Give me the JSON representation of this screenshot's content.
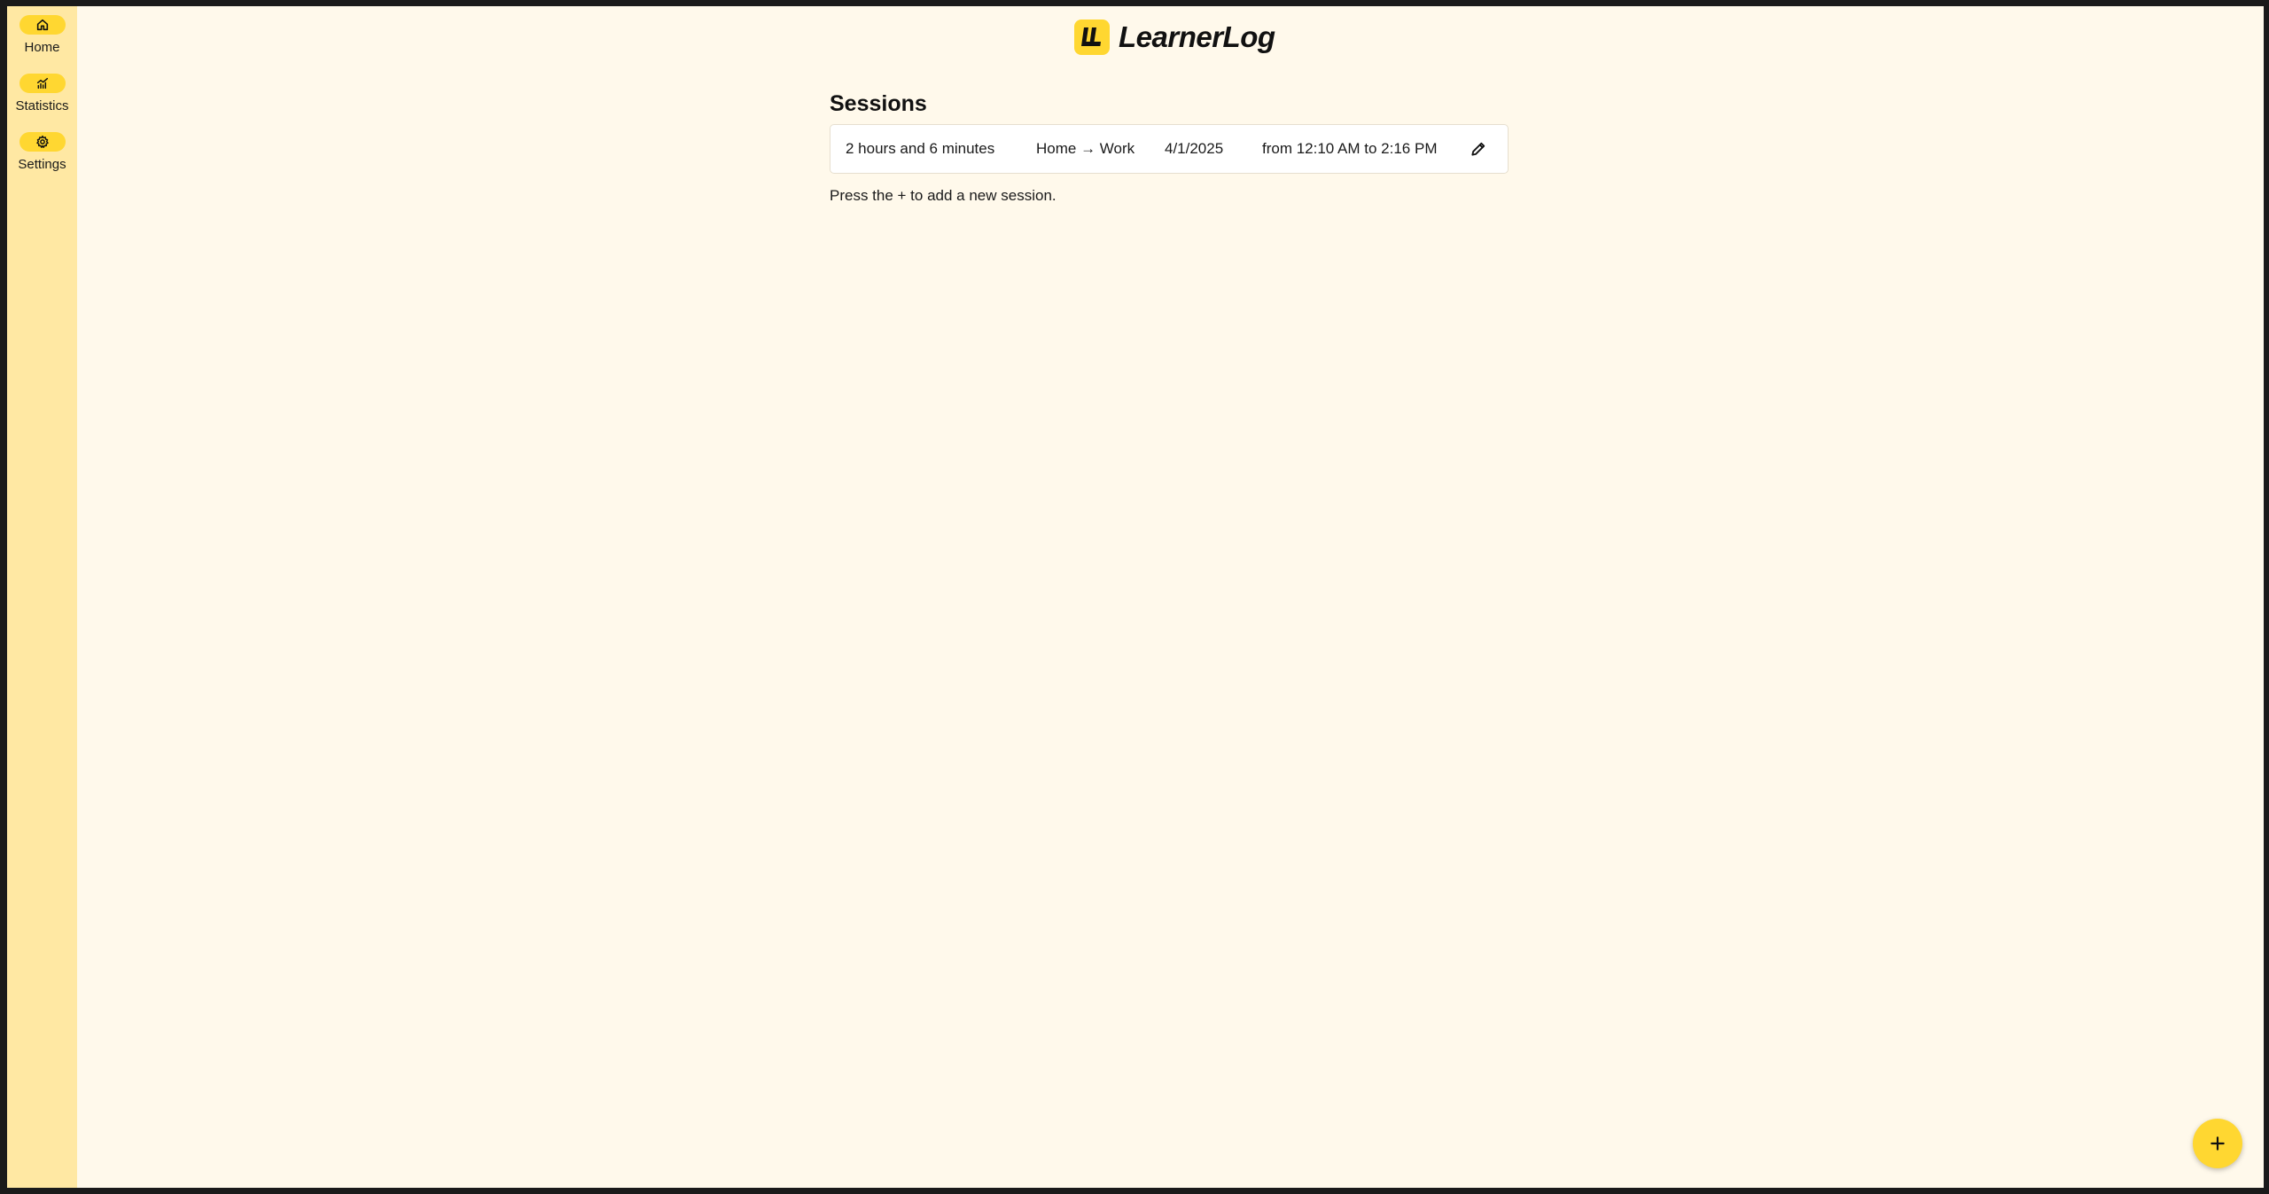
{
  "app": {
    "name": "LearnerLog",
    "accent_color": "#ffd731",
    "sidebar_color": "#ffe8a3",
    "background_color": "#fff9eb"
  },
  "sidebar": {
    "items": [
      {
        "label": "Home",
        "icon": "home-icon"
      },
      {
        "label": "Statistics",
        "icon": "chart-icon"
      },
      {
        "label": "Settings",
        "icon": "gear-icon"
      }
    ]
  },
  "main": {
    "title": "Sessions",
    "sessions": [
      {
        "duration": "2 hours and 6 minutes",
        "route": "Home → Work",
        "date": "4/1/2025",
        "time_range": "from 12:10 AM to 2:16 PM",
        "edit_icon": "pencil-icon"
      }
    ],
    "hint": "Press the + to add a new session."
  },
  "fab": {
    "icon": "plus-icon"
  }
}
